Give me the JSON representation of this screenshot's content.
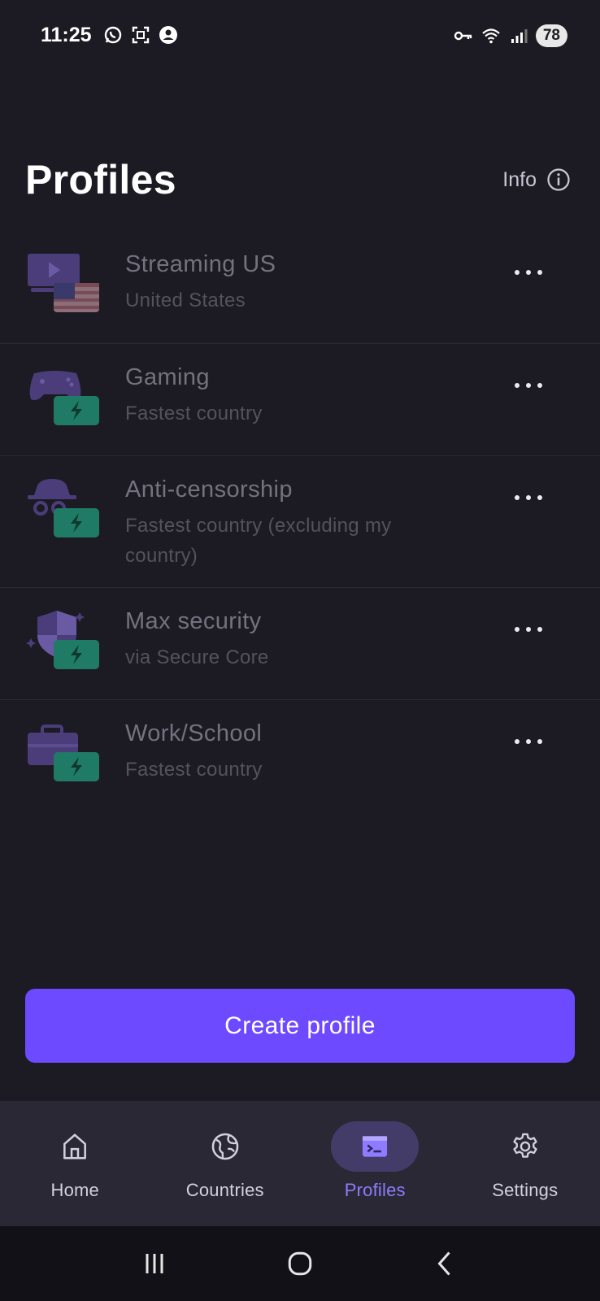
{
  "status_bar": {
    "time": "11:25",
    "battery": "78",
    "left_icons": [
      "whatsapp-icon",
      "screenshot-icon",
      "account-icon"
    ],
    "right_icons": [
      "vpn-key-icon",
      "wifi-icon",
      "signal-icon"
    ]
  },
  "header": {
    "title": "Profiles",
    "info_label": "Info"
  },
  "profiles": [
    {
      "name": "Streaming US",
      "subtitle": "United States",
      "icon": "streaming-us-icon"
    },
    {
      "name": "Gaming",
      "subtitle": "Fastest country",
      "icon": "gaming-icon"
    },
    {
      "name": "Anti-censorship",
      "subtitle": "Fastest country (excluding my country)",
      "icon": "anti-censorship-icon"
    },
    {
      "name": "Max security",
      "subtitle": "via Secure Core",
      "icon": "max-security-icon"
    },
    {
      "name": "Work/School",
      "subtitle": "Fastest country",
      "icon": "work-school-icon"
    }
  ],
  "create_button_label": "Create profile",
  "bottom_nav": {
    "items": [
      {
        "label": "Home",
        "icon": "home-icon",
        "active": false
      },
      {
        "label": "Countries",
        "icon": "globe-icon",
        "active": false
      },
      {
        "label": "Profiles",
        "icon": "profiles-icon",
        "active": true
      },
      {
        "label": "Settings",
        "icon": "gear-icon",
        "active": false
      }
    ]
  },
  "colors": {
    "background": "#1c1b23",
    "accent": "#6d4aff",
    "nav_background": "#292834",
    "active_nav_pill": "#443c68",
    "active_nav_label": "#8f7bff",
    "fastest_badge": "#1f7a66"
  }
}
